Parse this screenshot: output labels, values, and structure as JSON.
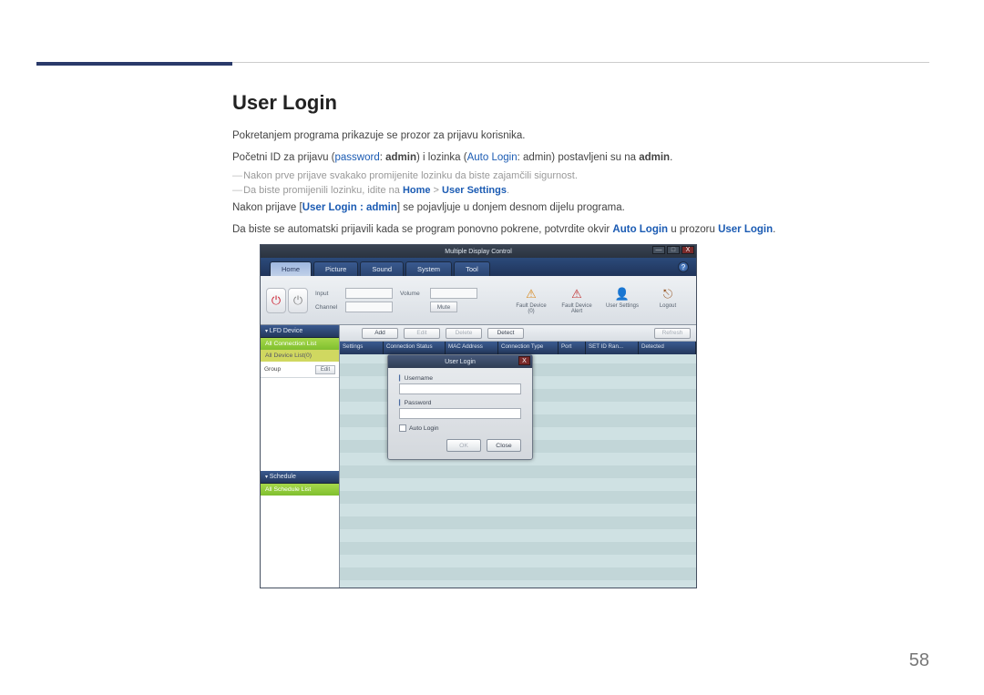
{
  "page": {
    "heading": "User Login",
    "p1": "Pokretanjem programa prikazuje se prozor za prijavu korisnika.",
    "p2_pre": "Početni ID za prijavu (",
    "p2_pwd": "password",
    "p2_mid1": ": ",
    "p2_admin1": "admin",
    "p2_mid2": ") i lozinka (",
    "p2_al": "Auto Login",
    "p2_mid3": ": admin) postavljeni su na ",
    "p2_admin2": "admin",
    "p2_end": ".",
    "n1": "Nakon prve prijave svakako promijenite lozinku da biste zajamčili sigurnost.",
    "n2_pre": "Da biste promijenili lozinku, idite na ",
    "n2_home": "Home",
    "n2_gt": " > ",
    "n2_us": "User Settings",
    "n2_end": ".",
    "p3_pre": "Nakon prijave [",
    "p3_ul": "User Login : admin",
    "p3_post": "] se pojavljuje u donjem desnom dijelu programa.",
    "p4_pre": "Da biste se automatski prijavili kada se program ponovno pokrene, potvrdite okvir ",
    "p4_al": "Auto Login",
    "p4_mid": " u prozoru ",
    "p4_ul": "User Login",
    "p4_end": ".",
    "number": "58"
  },
  "ss": {
    "title": "Multiple Display Control",
    "win_min": "—",
    "win_max": "□",
    "win_close": "X",
    "tabs": [
      "Home",
      "Picture",
      "Sound",
      "System",
      "Tool"
    ],
    "toolbar": {
      "on": "⏻",
      "off": "⏻",
      "input_lbl": "Input",
      "channel_lbl": "Channel",
      "volume_lbl": "Volume",
      "mute": "Mute",
      "actions": [
        {
          "icon": "⚠",
          "label": "Fault Device (0)"
        },
        {
          "icon": "⚠",
          "label": "Fault Device Alert"
        },
        {
          "icon": "👤",
          "label": "User Settings"
        },
        {
          "icon": "⎋",
          "label": "Logout"
        }
      ]
    },
    "left": {
      "lfd": "LFD Device",
      "conn": "All Connection List",
      "dev": "All Device List(0)",
      "group": "Group",
      "edit": "Edit",
      "sched": "Schedule",
      "sl": "All Schedule List"
    },
    "actbar": {
      "add": "Add",
      "edit": "Edit",
      "delete": "Delete",
      "detect": "Detect",
      "refresh": "Refresh"
    },
    "cols": [
      "Settings",
      "Connection Status",
      "MAC Address",
      "Connection Type",
      "Port",
      "SET ID Ran...",
      "Detected"
    ],
    "dlg": {
      "title": "User Login",
      "user": "Username",
      "pwd": "Password",
      "auto": "Auto Login",
      "ok": "OK",
      "close": "Close"
    }
  }
}
